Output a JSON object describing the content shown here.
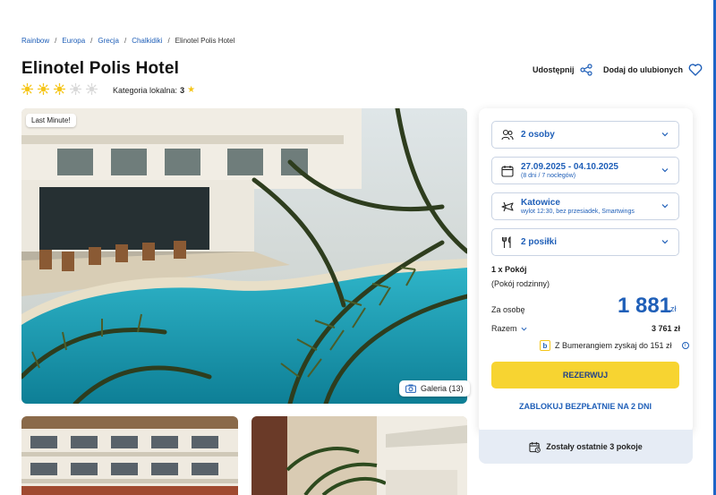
{
  "breadcrumb": [
    "Rainbow",
    "Europa",
    "Grecja",
    "Chalkidiki",
    "Elinotel Polis Hotel"
  ],
  "hotel": {
    "name": "Elinotel Polis Hotel",
    "sun_rating": 3,
    "sun_max": 5,
    "local_category_label": "Kategoria lokalna:",
    "local_category_value": "3"
  },
  "actions": {
    "share_label": "Udostępnij",
    "favorite_label": "Dodaj do ulubionych"
  },
  "gallery": {
    "badge": "Last Minute!",
    "button_label": "Galeria (13)"
  },
  "booking": {
    "persons": "2 osoby",
    "dates": "27.09.2025 - 04.10.2025",
    "dates_sub": "(8 dni / 7 noclegów)",
    "departure": "Katowice",
    "departure_sub": "wylot 12:30, bez przesiadek, Smartwings",
    "meals": "2 posiłki",
    "room_count": "1 x Pokój",
    "room_type": "(Pokój rodzinny)",
    "per_person_label": "Za osobę",
    "price": "1 881",
    "currency": "zł",
    "total_label": "Razem",
    "total_value": "3 761 zł",
    "bumerang_text": "Z Bumerangiem zyskaj do 151 zł",
    "reserve_label": "REZERWUJ",
    "block_label": "ZABLOKUJ BEZPŁATNIE NA 2 DNI",
    "rooms_left": "Zostały ostatnie 3 pokoje"
  },
  "colors": {
    "accent": "#1f5fb8",
    "cta": "#f7d431",
    "sun": "#f5c518"
  }
}
